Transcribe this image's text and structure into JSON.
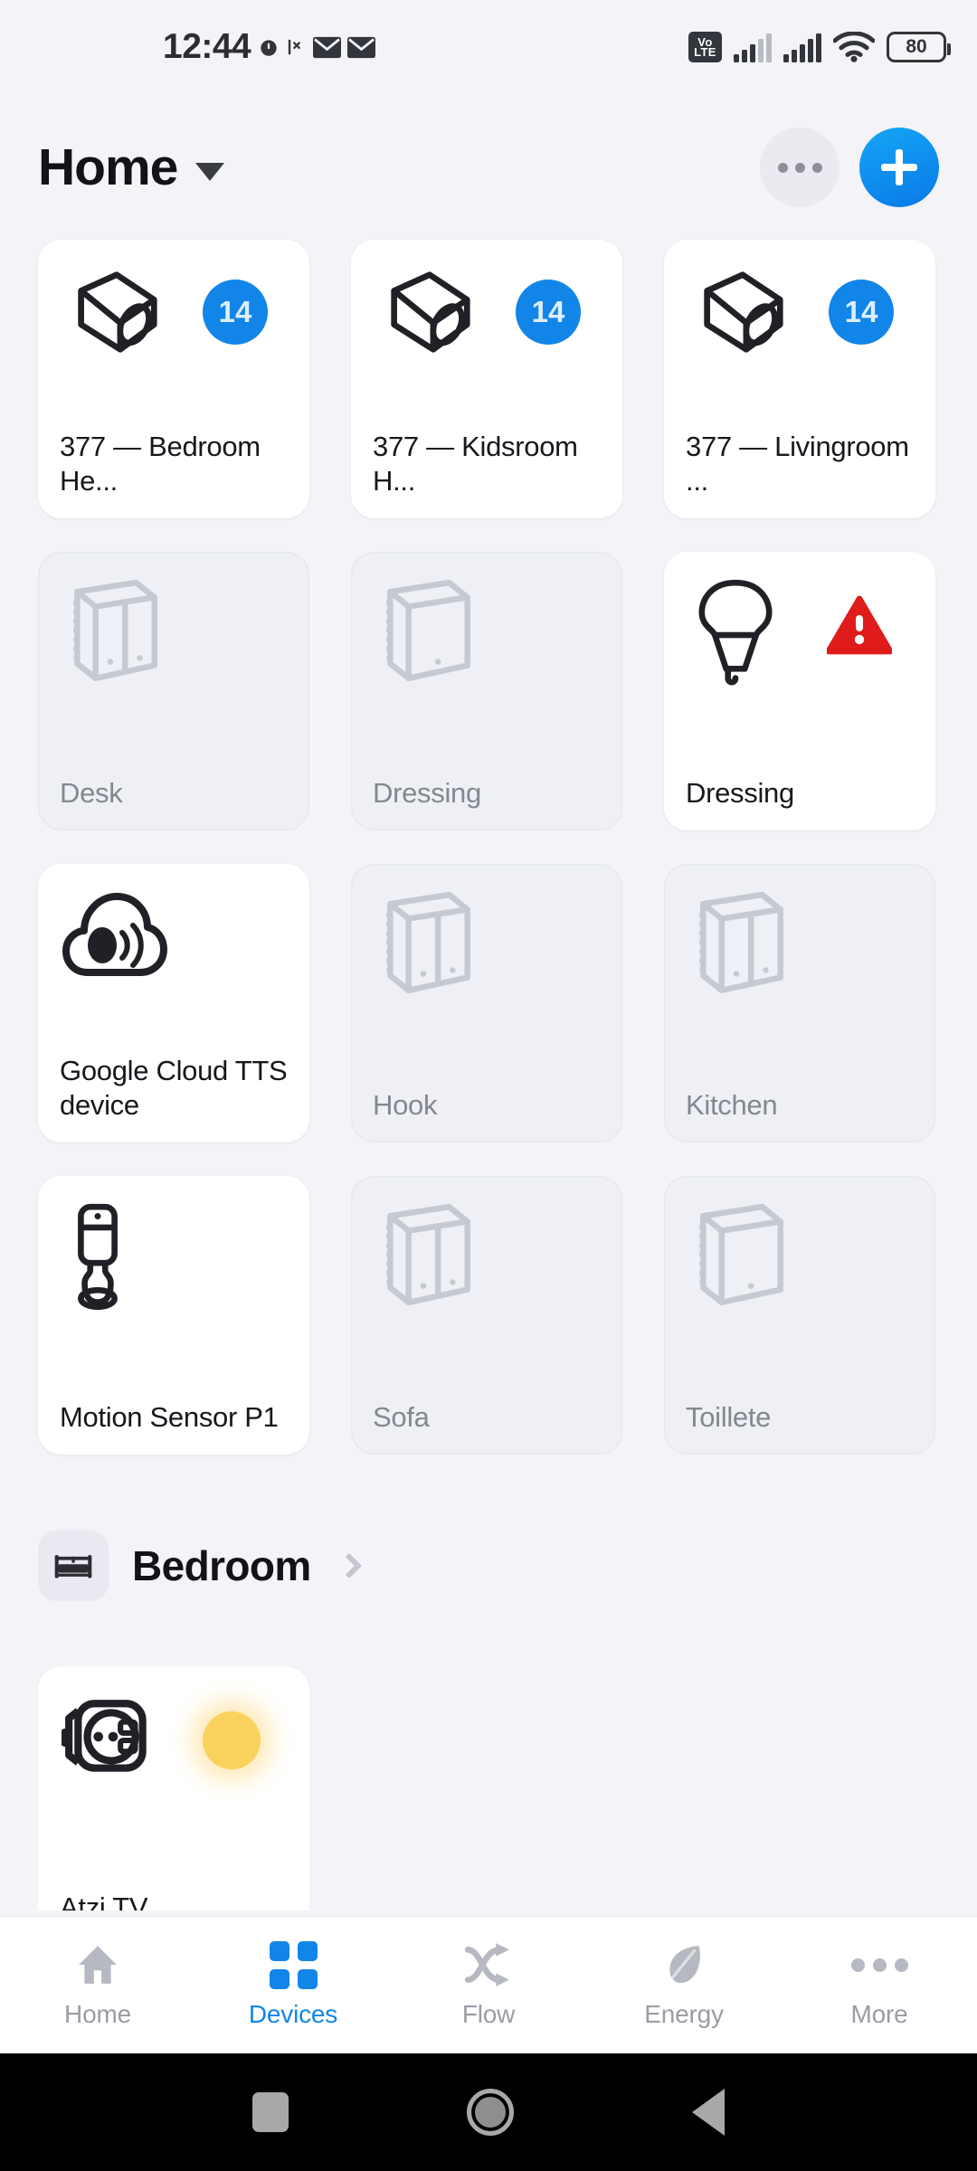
{
  "status_bar": {
    "clock": "12:44",
    "battery_level": "80",
    "icons": [
      "alarm-icon",
      "mute-icon",
      "mail-icon",
      "mail-icon",
      "volte-icon",
      "signal-icon",
      "signal-icon",
      "wifi-icon",
      "battery-icon"
    ],
    "volte_top": "Vo",
    "volte_bottom": "LTE"
  },
  "header": {
    "title": "Home",
    "more_label": "",
    "add_label": ""
  },
  "devices": [
    {
      "name": "377 — Bedroom He...",
      "icon": "thermostat-valve-icon",
      "state": "on",
      "badge_type": "number",
      "badge_value": "14"
    },
    {
      "name": "377 — Kidsroom H...",
      "icon": "thermostat-valve-icon",
      "state": "on",
      "badge_type": "number",
      "badge_value": "14"
    },
    {
      "name": "377 — Livingroom ...",
      "icon": "thermostat-valve-icon",
      "state": "on",
      "badge_type": "number",
      "badge_value": "14"
    },
    {
      "name": "Desk",
      "icon": "wall-switch-double-icon",
      "state": "off",
      "badge_type": "none",
      "badge_value": ""
    },
    {
      "name": "Dressing",
      "icon": "wall-switch-single-icon",
      "state": "off",
      "badge_type": "none",
      "badge_value": ""
    },
    {
      "name": "Dressing",
      "icon": "light-bulb-icon",
      "state": "on",
      "badge_type": "warning",
      "badge_value": "!"
    },
    {
      "name": "Google Cloud TTS device",
      "icon": "cloud-speaker-icon",
      "state": "on",
      "badge_type": "none",
      "badge_value": ""
    },
    {
      "name": "Hook",
      "icon": "wall-switch-double-icon",
      "state": "off",
      "badge_type": "none",
      "badge_value": ""
    },
    {
      "name": "Kitchen",
      "icon": "wall-switch-double-icon",
      "state": "off",
      "badge_type": "none",
      "badge_value": ""
    },
    {
      "name": "Motion Sensor P1",
      "icon": "motion-sensor-icon",
      "state": "on",
      "badge_type": "none",
      "badge_value": ""
    },
    {
      "name": "Sofa",
      "icon": "wall-switch-double-icon",
      "state": "off",
      "badge_type": "none",
      "badge_value": ""
    },
    {
      "name": "Toillete",
      "icon": "wall-switch-single-icon",
      "state": "off",
      "badge_type": "none",
      "badge_value": ""
    }
  ],
  "section": {
    "title": "Bedroom",
    "icon": "bed-icon"
  },
  "section_devices": [
    {
      "name": "Atzi TV",
      "icon": "smart-plug-icon",
      "state": "on",
      "badge_type": "glow",
      "badge_value": ""
    }
  ],
  "bottom_nav": {
    "items": [
      {
        "label": "Home",
        "icon": "house-icon",
        "active": false
      },
      {
        "label": "Devices",
        "icon": "grid-squares-icon",
        "active": true
      },
      {
        "label": "Flow",
        "icon": "flow-arrows-icon",
        "active": false
      },
      {
        "label": "Energy",
        "icon": "leaf-icon",
        "active": false
      },
      {
        "label": "More",
        "icon": "ellipsis-icon",
        "active": false
      }
    ]
  },
  "android_nav": {
    "recents_label": "Recents",
    "home_label": "Home",
    "back_label": "Back"
  },
  "colors": {
    "accent": "#1285e8",
    "warning": "#e01b1b",
    "glow": "#fbd15e",
    "background": "#f3f3f8",
    "card_on": "#ffffff",
    "card_off": "#eef0f5"
  }
}
